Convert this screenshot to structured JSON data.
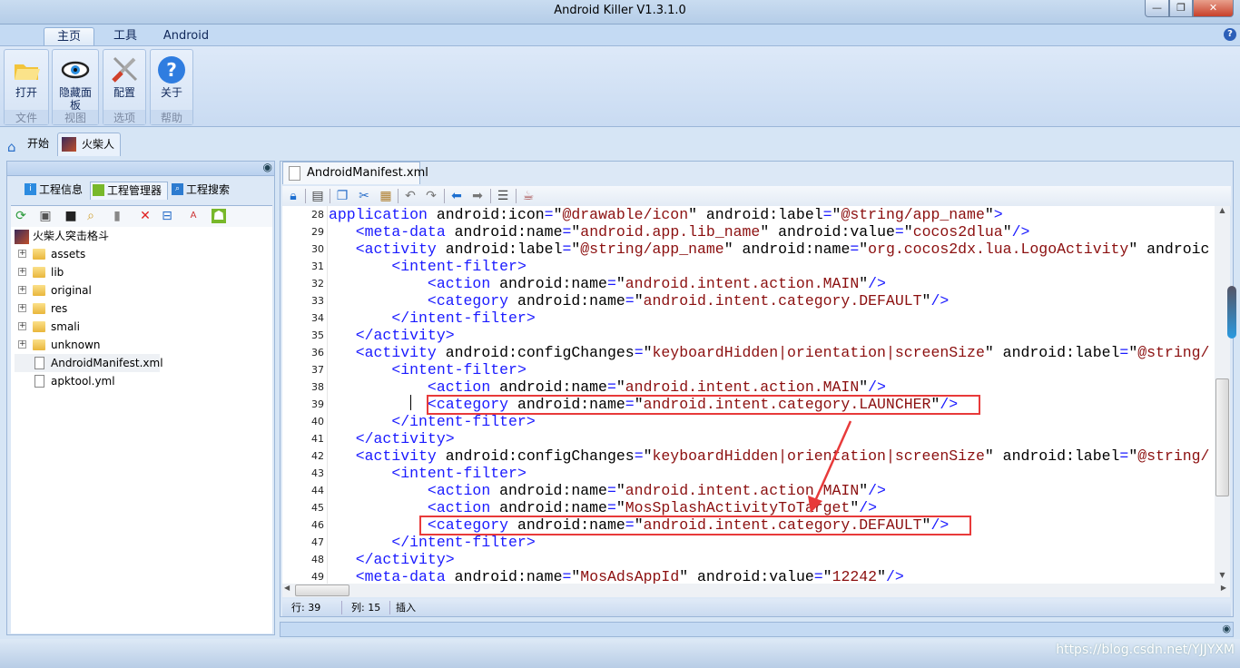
{
  "window": {
    "title": "Android Killer V1.3.1.0",
    "minimize": "—",
    "restore": "❐",
    "close": "✕"
  },
  "ribbon": {
    "tabs": [
      {
        "label": "主页"
      },
      {
        "label": "工具"
      },
      {
        "label": "Android"
      }
    ],
    "help_icon": "?",
    "groups": [
      {
        "button": "打开",
        "group": "文件",
        "icon": "open-folder-icon"
      },
      {
        "button": "隐藏面板",
        "group": "视图",
        "icon": "eye-icon"
      },
      {
        "button": "配置",
        "group": "选项",
        "icon": "tools-icon"
      },
      {
        "button": "关于",
        "group": "帮助",
        "icon": "help-icon"
      }
    ]
  },
  "doc_tabs": [
    {
      "label": "开始"
    },
    {
      "label": "火柴人"
    }
  ],
  "left_panel": {
    "tabs": [
      {
        "label": "工程信息"
      },
      {
        "label": "工程管理器"
      },
      {
        "label": "工程搜索"
      }
    ],
    "tree": {
      "root": "火柴人突击格斗",
      "items": [
        {
          "label": "assets",
          "type": "folder"
        },
        {
          "label": "lib",
          "type": "folder"
        },
        {
          "label": "original",
          "type": "folder"
        },
        {
          "label": "res",
          "type": "folder"
        },
        {
          "label": "smali",
          "type": "folder"
        },
        {
          "label": "unknown",
          "type": "folder"
        },
        {
          "label": "AndroidManifest.xml",
          "type": "file",
          "selected": true
        },
        {
          "label": "apktool.yml",
          "type": "file"
        }
      ]
    }
  },
  "editor": {
    "tab": "AndroidManifest.xml",
    "lines": [
      {
        "n": "28",
        "text": "application android:icon=\"@drawable/icon\" android:label=\"@string/app_name\">"
      },
      {
        "n": "29",
        "text": "   <meta-data android:name=\"android.app.lib_name\" android:value=\"cocos2dlua\"/>"
      },
      {
        "n": "30",
        "text": "   <activity android:label=\"@string/app_name\" android:name=\"org.cocos2dx.lua.LogoActivity\" androic"
      },
      {
        "n": "31",
        "text": "       <intent-filter>"
      },
      {
        "n": "32",
        "text": "           <action android:name=\"android.intent.action.MAIN\"/>"
      },
      {
        "n": "33",
        "text": "           <category android:name=\"android.intent.category.DEFAULT\"/>"
      },
      {
        "n": "34",
        "text": "       </intent-filter>"
      },
      {
        "n": "35",
        "text": "   </activity>"
      },
      {
        "n": "36",
        "text": "   <activity android:configChanges=\"keyboardHidden|orientation|screenSize\" android:label=\"@string/"
      },
      {
        "n": "37",
        "text": "       <intent-filter>"
      },
      {
        "n": "38",
        "text": "           <action android:name=\"android.intent.action.MAIN\"/>"
      },
      {
        "n": "39",
        "text": "           <category android:name=\"android.intent.category.LAUNCHER\"/>"
      },
      {
        "n": "40",
        "text": "       </intent-filter>"
      },
      {
        "n": "41",
        "text": "   </activity>"
      },
      {
        "n": "42",
        "text": "   <activity android:configChanges=\"keyboardHidden|orientation|screenSize\" android:label=\"@string/"
      },
      {
        "n": "43",
        "text": "       <intent-filter>"
      },
      {
        "n": "44",
        "text": "           <action android:name=\"android.intent.action.MAIN\"/>"
      },
      {
        "n": "45",
        "text": "           <action android:name=\"MosSplashActivityToTarget\"/>"
      },
      {
        "n": "46",
        "text": "           <category android:name=\"android.intent.category.DEFAULT\"/>"
      },
      {
        "n": "47",
        "text": "       </intent-filter>"
      },
      {
        "n": "48",
        "text": "   </activity>"
      },
      {
        "n": "49",
        "text": "   <meta-data android:name=\"MosAdsAppId\" android:value=\"12242\"/>"
      }
    ],
    "status": {
      "row": "行: 39",
      "col": "列: 15",
      "mode": "插入"
    },
    "annotation_color": "#e83a3a"
  },
  "watermark": "https://blog.csdn.net/YJJYXM"
}
